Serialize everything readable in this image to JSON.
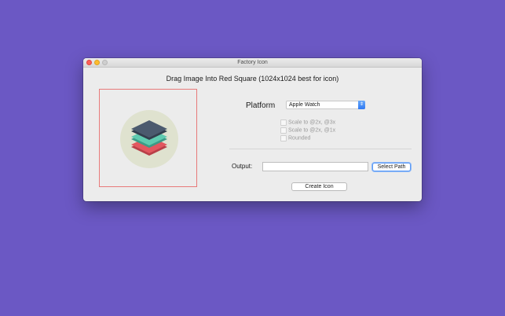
{
  "window": {
    "title": "Factory Icon"
  },
  "heading": "Drag Image Into Red Square (1024x1024 best for icon)",
  "drop_zone": {
    "icon": "layers-stack-icon",
    "colors": {
      "border": "#e87a7a",
      "circle": "#dfe2cf",
      "layer_top": "#4b5a6e",
      "layer_middle": "#5fcbb0",
      "layer_bottom": "#e2575f"
    }
  },
  "platform": {
    "label": "Platform",
    "selected": "Apple Watch"
  },
  "options": [
    {
      "label": "Scale to @2x, @3x",
      "checked": false
    },
    {
      "label": "Scale to @2x, @1x",
      "checked": false
    },
    {
      "label": "Rounded",
      "checked": false
    }
  ],
  "output": {
    "label": "Output:",
    "value": "",
    "select_path_label": "Select Path"
  },
  "create_label": "Create Icon"
}
